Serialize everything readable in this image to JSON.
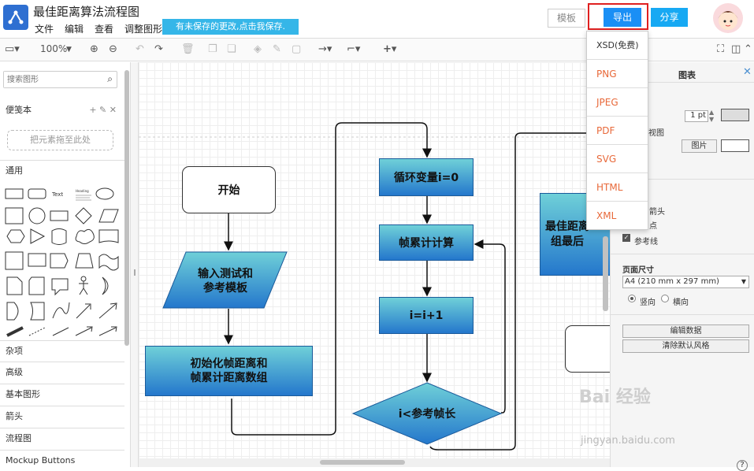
{
  "app": {
    "title": "最佳距离算法流程图",
    "unsaved_notice": "有未保存的更改,点击我保存."
  },
  "menu": [
    "文件",
    "编辑",
    "查看",
    "调整图形"
  ],
  "header_buttons": {
    "template": "模板",
    "export": "导出",
    "share": "分享"
  },
  "toolbar": {
    "zoom": "100%"
  },
  "export_menu": [
    "XSD(免费)",
    "PNG",
    "JPEG",
    "PDF",
    "SVG",
    "HTML",
    "XML"
  ],
  "sidebar": {
    "search_placeholder": "搜索图形",
    "scratchpad": "便笺本",
    "drop_hint": "把元素拖至此处",
    "general": "通用",
    "sections": [
      "杂项",
      "高级",
      "基本图形",
      "箭头",
      "流程图",
      "Mockup Buttons"
    ]
  },
  "flow": {
    "start": "开始",
    "input": "输入测试和\n参考模板",
    "init": "初始化帧距离和\n帧累计距离数组",
    "loop": "循环变量i=0",
    "accum": "帧累计计算",
    "incr": "i=i+1",
    "cond": "i<参考帧长",
    "best": "最佳距离\n组最后"
  },
  "right_panel": {
    "title": "图表",
    "line_width": "1 pt",
    "view_label": "视图",
    "image_btn": "图片",
    "arrow_label": "箭头",
    "point_label": "点",
    "guide_label": "参考线",
    "page_size_label": "页面尺寸",
    "page_size_value": "A4 (210 mm x 297 mm)",
    "portrait": "竖向",
    "landscape": "横向",
    "edit_data": "编辑数据",
    "clear_style": "清除默认风格"
  },
  "watermark": {
    "brand": "Bai 经验",
    "url": "jingyan.baidu.com"
  }
}
